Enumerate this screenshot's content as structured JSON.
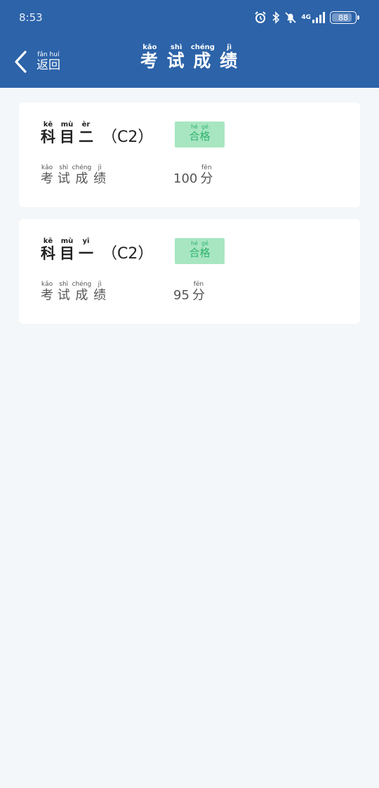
{
  "status_bar": {
    "time": "8:53",
    "network": "4G",
    "battery": "88",
    "icons": [
      "alarm-icon",
      "bluetooth-icon",
      "mute-icon",
      "signal-icon",
      "battery-icon"
    ]
  },
  "header": {
    "back": [
      {
        "char": "返",
        "pinyin": "fǎn"
      },
      {
        "char": "回",
        "pinyin": "huí"
      }
    ],
    "title": [
      {
        "char": "考",
        "pinyin": "kǎo"
      },
      {
        "char": "试",
        "pinyin": "shì"
      },
      {
        "char": "成",
        "pinyin": "chéng"
      },
      {
        "char": "绩",
        "pinyin": "jì"
      }
    ],
    "bg_color": "#2c63a9"
  },
  "results": [
    {
      "subject": [
        {
          "char": "科",
          "pinyin": "kē"
        },
        {
          "char": "目",
          "pinyin": "mù"
        },
        {
          "char": "二",
          "pinyin": "èr"
        }
      ],
      "license": "（C2）",
      "status": [
        {
          "char": "合",
          "pinyin": "hé"
        },
        {
          "char": "格",
          "pinyin": "gé"
        }
      ],
      "label": [
        {
          "char": "考",
          "pinyin": "kǎo"
        },
        {
          "char": "试",
          "pinyin": "shì"
        },
        {
          "char": "成",
          "pinyin": "chéng"
        },
        {
          "char": "绩",
          "pinyin": "jì"
        }
      ],
      "score": "100",
      "unit": {
        "char": "分",
        "pinyin": "fēn"
      }
    },
    {
      "subject": [
        {
          "char": "科",
          "pinyin": "kē"
        },
        {
          "char": "目",
          "pinyin": "mù"
        },
        {
          "char": "一",
          "pinyin": "yī"
        }
      ],
      "license": "（C2）",
      "status": [
        {
          "char": "合",
          "pinyin": "hé"
        },
        {
          "char": "格",
          "pinyin": "gé"
        }
      ],
      "label": [
        {
          "char": "考",
          "pinyin": "kǎo"
        },
        {
          "char": "试",
          "pinyin": "shì"
        },
        {
          "char": "成",
          "pinyin": "chéng"
        },
        {
          "char": "绩",
          "pinyin": "jì"
        }
      ],
      "score": "95",
      "unit": {
        "char": "分",
        "pinyin": "fēn"
      }
    }
  ],
  "colors": {
    "pass_badge_bg": "#a8e6c2",
    "pass_badge_text": "#2fb36d",
    "page_bg": "#f4f7f9"
  }
}
